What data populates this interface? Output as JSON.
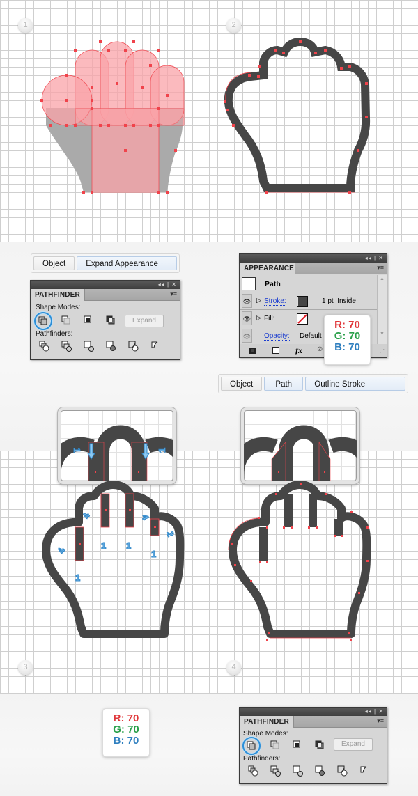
{
  "steps": [
    {
      "number": "1"
    },
    {
      "number": "2"
    },
    {
      "number": "3"
    },
    {
      "number": "4"
    }
  ],
  "menu_expand_appearance": {
    "items": [
      "Object",
      "Expand Appearance"
    ]
  },
  "menu_outline_stroke": {
    "items": [
      "Object",
      "Path",
      "Outline Stroke"
    ]
  },
  "pathfinder_panel": {
    "title": "PATHFINDER",
    "bar_controls": "◂◂ | ✕",
    "menu_icon": "▾≡",
    "shape_modes_label": "Shape Modes:",
    "shape_modes": [
      "unite-icon",
      "minus-front-icon",
      "intersect-icon",
      "exclude-icon"
    ],
    "selected_shape_mode": "unite-icon",
    "expand_label": "Expand",
    "pathfinders_label": "Pathfinders:",
    "pathfinders": [
      "divide-icon",
      "trim-icon",
      "merge-icon",
      "crop-icon",
      "outline-icon",
      "minus-back-icon"
    ]
  },
  "appearance_panel": {
    "title": "APPEARANCE",
    "bar_controls": "◂◂ | ✕",
    "menu_icon": "▾≡",
    "object_label": "Path",
    "rows": [
      {
        "label": "Stroke:",
        "swatch": "#464646",
        "value": "1 pt  Inside"
      },
      {
        "label": "Fill:",
        "swatch": "none",
        "value": ""
      },
      {
        "label": "Opacity:",
        "value": "Default"
      }
    ],
    "footer_icons": [
      "add-stroke-icon",
      "add-fill-icon",
      "fx-icon",
      "clear-appearance-icon"
    ],
    "fx_label": "fx"
  },
  "rgb_cards": [
    {
      "r": "R: 70",
      "g": "G: 70",
      "b": "B: 70"
    },
    {
      "r": "R: 70",
      "g": "G: 70",
      "b": "B: 70"
    }
  ],
  "step3_annotations": {
    "zoom_arrows_label": "1",
    "labels": [
      "4",
      "4",
      "4",
      "2",
      "1",
      "1",
      "1",
      "1"
    ]
  },
  "colors": {
    "stroke_gray": "#464646",
    "anchor_red": "#f0434b",
    "shape_pink": "#f9a3a8",
    "annotation_blue": "#2f86c8"
  }
}
